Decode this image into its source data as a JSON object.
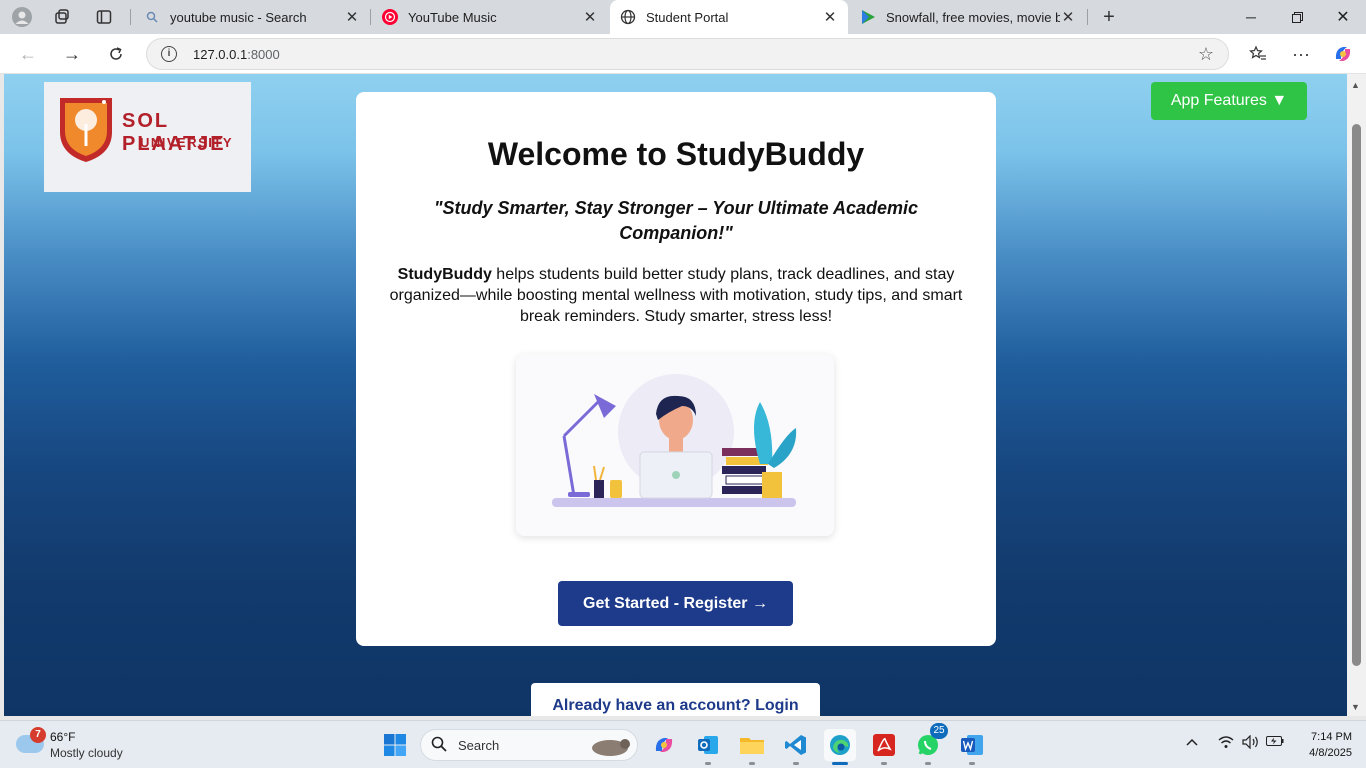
{
  "tabs": [
    {
      "title": "youtube music - Search",
      "icon": "search-icon"
    },
    {
      "title": "YouTube Music",
      "icon": "youtube-music-icon"
    },
    {
      "title": "Student Portal",
      "icon": "globe-icon",
      "active": true
    },
    {
      "title": "Snowfall, free movies, movie box,",
      "icon": "play-icon"
    }
  ],
  "address": {
    "host": "127.0.0.1",
    "port": ":8000"
  },
  "page": {
    "logo": {
      "line1": "SOL PLAATJE",
      "line2": "UNIVERSITY"
    },
    "features_button": "App Features ▼",
    "heading": "Welcome to StudyBuddy",
    "tagline": "\"Study Smarter, Stay Stronger – Your Ultimate Academic Companion!\"",
    "desc_brand": "StudyBuddy",
    "desc_rest": " helps students build better study plans, track deadlines, and stay organized—while boosting mental wellness with motivation, study tips, and smart break reminders. Study smarter, stress less!",
    "cta": "Get Started - Register →",
    "login": "Already have an account? Login"
  },
  "taskbar": {
    "weather_badge": "7",
    "temperature": "66°F",
    "condition": "Mostly cloudy",
    "search_label": "Search",
    "whatsapp_badge": "25",
    "time": "7:14 PM",
    "date": "4/8/2025"
  },
  "colors": {
    "features_green": "#2fc445",
    "cta_navy": "#1e3a8a",
    "logo_red": "#b3202a"
  }
}
